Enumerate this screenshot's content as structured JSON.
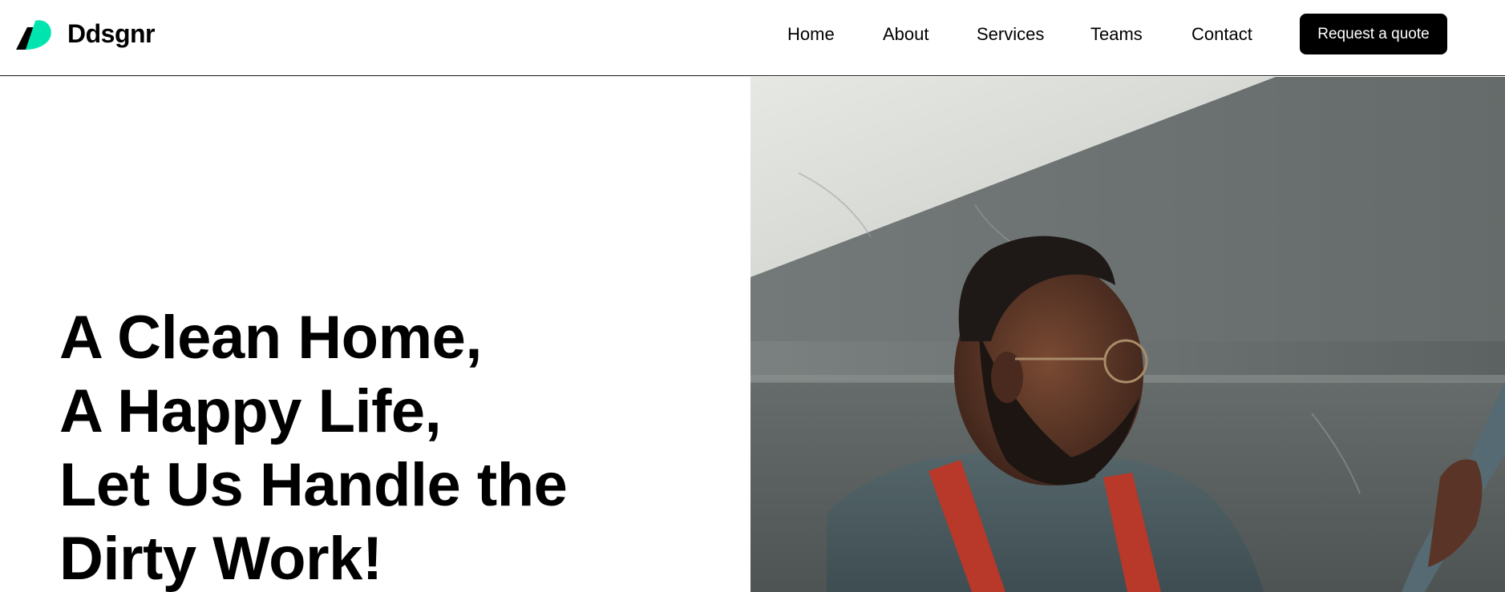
{
  "brand": {
    "name": "Ddsgnr",
    "logo_icon": "leaf-logo-icon",
    "logo_colors": {
      "primary": "#00e5b0",
      "secondary": "#000000"
    }
  },
  "nav": {
    "items": [
      {
        "label": "Home"
      },
      {
        "label": "About"
      },
      {
        "label": "Services"
      },
      {
        "label": "Teams"
      },
      {
        "label": "Contact"
      }
    ],
    "cta_label": "Request a quote"
  },
  "hero": {
    "headline_lines": [
      "A Clean Home,",
      "A Happy Life,",
      "Let Us Handle the",
      "Dirty Work!"
    ],
    "image_alt": "Cleaner wearing glasses and red overall straps holding a mop handle"
  },
  "colors": {
    "background": "#ffffff",
    "text": "#000000",
    "button_bg": "#000000",
    "button_text": "#ffffff",
    "accent": "#00e5b0"
  }
}
